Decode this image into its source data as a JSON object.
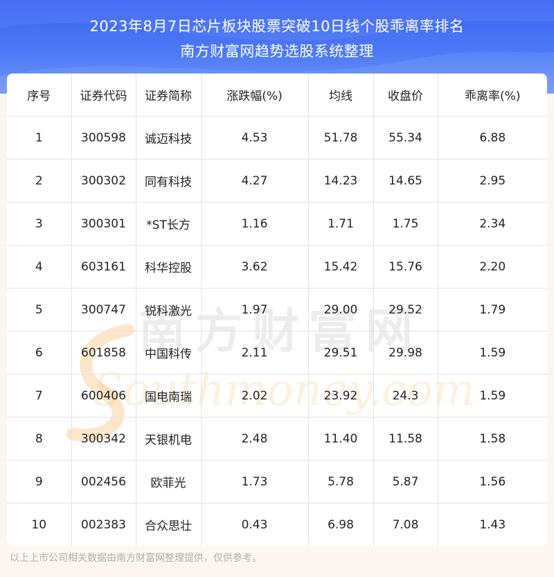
{
  "header": {
    "title_line1": "2023年8月7日芯片板块股票突破10日线个股乖离率排名",
    "title_line2": "南方财富网趋势选股系统整理"
  },
  "table": {
    "columns": [
      "序号",
      "证券代码",
      "证券简称",
      "涨跌幅(%)",
      "均线",
      "收盘价",
      "乖离率(%)"
    ],
    "rows": [
      [
        "1",
        "300598",
        "诚迈科技",
        "4.53",
        "51.78",
        "55.34",
        "6.88"
      ],
      [
        "2",
        "300302",
        "同有科技",
        "4.27",
        "14.23",
        "14.65",
        "2.95"
      ],
      [
        "3",
        "300301",
        "*ST长方",
        "1.16",
        "1.71",
        "1.75",
        "2.34"
      ],
      [
        "4",
        "603161",
        "科华控股",
        "3.62",
        "15.42",
        "15.76",
        "2.20"
      ],
      [
        "5",
        "300747",
        "锐科激光",
        "1.97",
        "29.00",
        "29.52",
        "1.79"
      ],
      [
        "6",
        "601858",
        "中国科传",
        "2.11",
        "29.51",
        "29.98",
        "1.59"
      ],
      [
        "7",
        "600406",
        "国电南瑞",
        "2.02",
        "23.92",
        "24.3",
        "1.59"
      ],
      [
        "8",
        "300342",
        "天银机电",
        "2.48",
        "11.40",
        "11.58",
        "1.58"
      ],
      [
        "9",
        "002456",
        "欧菲光",
        "1.73",
        "5.78",
        "5.87",
        "1.56"
      ],
      [
        "10",
        "002383",
        "合众思壮",
        "0.43",
        "6.98",
        "7.08",
        "1.43"
      ]
    ]
  },
  "watermark": {
    "text_cn": "南方财富网",
    "text_en": "Southmoney.com"
  },
  "footnote": "以上上市公司相关数据由南方财富网整理提供，仅供参考。",
  "colors": {
    "header_top": "#3b64f2",
    "header_bottom": "#6f98f8",
    "background": "#fbf6f0",
    "grid": "#e3e3e3"
  }
}
